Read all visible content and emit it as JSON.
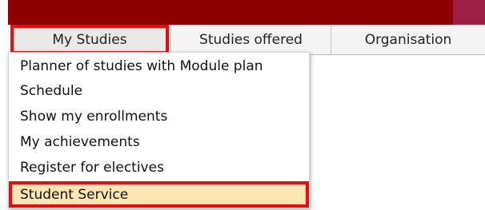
{
  "colors": {
    "topbar": "#8c0000",
    "highlight_outline": "#e30f0f",
    "selected_item_bg": "#fde6b4"
  },
  "nav": {
    "tabs": [
      {
        "label": "My Studies"
      },
      {
        "label": "Studies offered"
      },
      {
        "label": "Organisation"
      }
    ]
  },
  "menu": {
    "items": [
      {
        "label": "Planner of studies with Module plan"
      },
      {
        "label": "Schedule"
      },
      {
        "label": "Show my enrollments"
      },
      {
        "label": "My achievements"
      },
      {
        "label": "Register for electives"
      },
      {
        "label": "Student Service"
      }
    ]
  }
}
